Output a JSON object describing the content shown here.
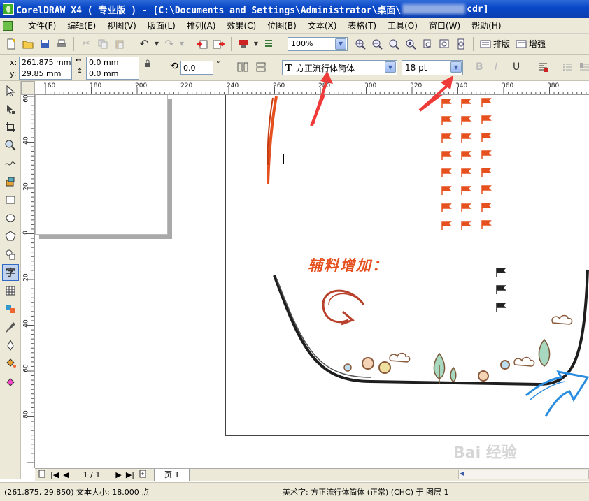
{
  "window": {
    "title_left": "CorelDRAW X4 ( 专业版 ) - [C:\\Documents and Settings\\Administrator\\桌面\\",
    "title_right": "cdr]"
  },
  "menu": [
    "文件(F)",
    "编辑(E)",
    "视图(V)",
    "版面(L)",
    "排列(A)",
    "效果(C)",
    "位图(B)",
    "文本(X)",
    "表格(T)",
    "工具(O)",
    "窗口(W)",
    "帮助(H)"
  ],
  "toolbar": {
    "zoom_value": "100%",
    "typeset_label": "排版",
    "enhance_label": "增强"
  },
  "properties": {
    "x_label": "x:",
    "x_value": "261.875 mm",
    "y_label": "y:",
    "y_value": "29.85 mm",
    "width_value": "0.0 mm",
    "height_value": "0.0 mm",
    "angle_value": "0.0",
    "angle_unit": "°",
    "font_name": "方正流行体简体",
    "font_size": "18 pt"
  },
  "ruler": {
    "h_labels": [
      "160",
      "180",
      "200",
      "220",
      "240",
      "260",
      "280",
      "300",
      "320",
      "340",
      "360",
      "380"
    ],
    "v_labels": [
      "60",
      "40",
      "20",
      "0",
      "20",
      "40",
      "60",
      "80"
    ]
  },
  "canvas": {
    "heading_text": "辅料增加："
  },
  "pagebar": {
    "page_counter": "1 / 1",
    "page_tab": "页 1"
  },
  "status": {
    "left_text": "(261.875, 29.850)  文本大小: 18.000 点",
    "right_text": "美术字: 方正流行体简体 (正常) (CHC) 于 图层 1"
  },
  "watermark": "Bai 经验",
  "colors": {
    "titlebar": "#0a48c8",
    "chrome": "#ece9d8",
    "orange": "#e5501e",
    "blue_arrow": "#2a8de0",
    "annotation_red": "#ef3a3a"
  }
}
